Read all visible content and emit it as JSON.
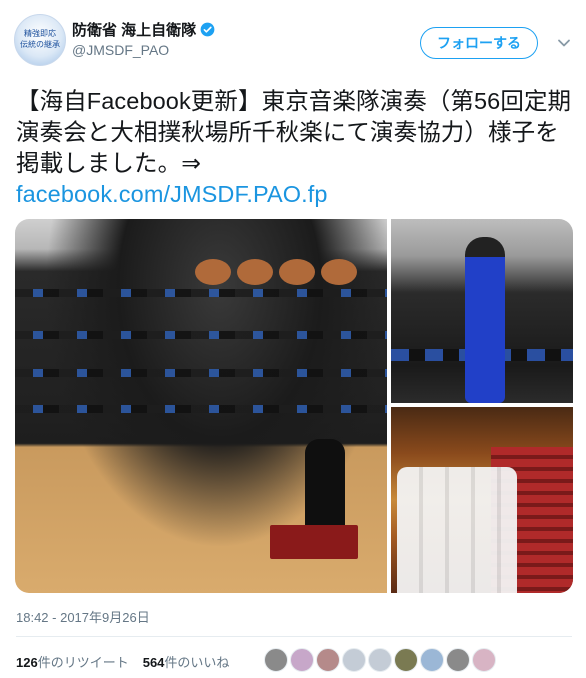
{
  "account": {
    "display_name": "防衛省 海上自衛隊",
    "handle": "@JMSDF_PAO",
    "avatar_text_line1": "精強即応",
    "avatar_text_line2": "伝統の継承",
    "verified": true
  },
  "follow_button": {
    "label": "フォローする"
  },
  "tweet": {
    "text": "【海自Facebook更新】東京音楽隊演奏（第56回定期演奏会と大相撲秋場所千秋楽にて演奏協力）様子を掲載しました。⇒",
    "link": "facebook.com/JMSDF.PAO.fp",
    "timestamp": "18:42 - 2017年9月26日"
  },
  "media": [
    {
      "label": "concert-band-photo"
    },
    {
      "label": "singer-photo"
    },
    {
      "label": "sumo-venue-photo"
    }
  ],
  "stats": {
    "retweets_count": "126",
    "retweets_label": "件のリツイート",
    "likes_count": "564",
    "likes_label": "件のいいね"
  },
  "likers": [
    {
      "color": "#8a8a8a"
    },
    {
      "color": "#c7a7c9"
    },
    {
      "color": "#b58a8a"
    },
    {
      "color": "#c4ccd6"
    },
    {
      "color": "#c4ccd6"
    },
    {
      "color": "#7a7a52"
    },
    {
      "color": "#9bb7d6"
    },
    {
      "color": "#8a8a8a"
    },
    {
      "color": "#d8b4c4"
    }
  ],
  "colors": {
    "accent": "#1da1f2",
    "link": "#1b95e0",
    "muted": "#657786"
  }
}
